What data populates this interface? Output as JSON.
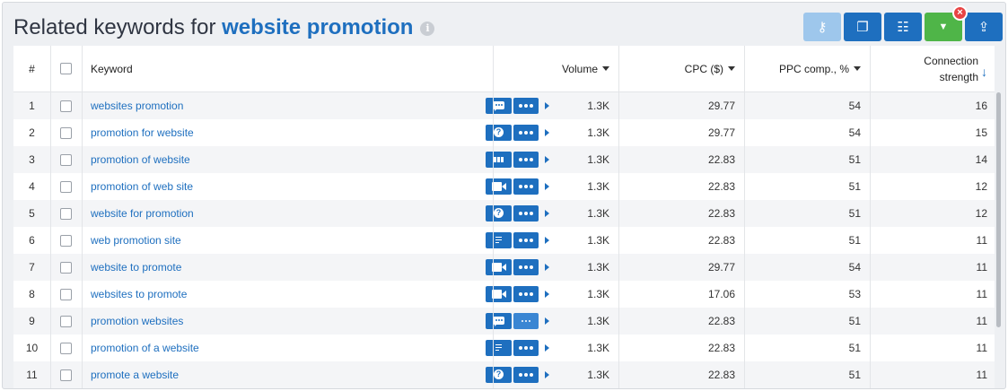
{
  "title": {
    "prefix": "Related keywords for ",
    "keyword": "website promotion",
    "info_icon": "info-icon"
  },
  "toolbar": {
    "buttons": [
      {
        "name": "key-icon",
        "glyph": "⚷"
      },
      {
        "name": "copy-icon",
        "glyph": "❐"
      },
      {
        "name": "columns-icon",
        "glyph": "☷"
      },
      {
        "name": "filter-icon",
        "glyph": "▼"
      },
      {
        "name": "export-icon",
        "glyph": "⇪"
      }
    ],
    "filter_clear_glyph": "×"
  },
  "columns": {
    "num": "#",
    "keyword": "Keyword",
    "volume": "Volume",
    "cpc": "CPC ($)",
    "ppc": "PPC comp., %",
    "connection_line1": "Connection",
    "connection_line2": "strength",
    "connection_sort_glyph": "↓"
  },
  "rows": [
    {
      "num": "1",
      "keyword": "websites promotion",
      "icon": "chat-icon",
      "volume": "1.3K",
      "cpc": "29.77",
      "ppc": "54",
      "connection": "16"
    },
    {
      "num": "2",
      "keyword": "promotion for website",
      "icon": "question-icon",
      "volume": "1.3K",
      "cpc": "29.77",
      "ppc": "54",
      "connection": "15"
    },
    {
      "num": "3",
      "keyword": "promotion of website",
      "icon": "bars-icon",
      "volume": "1.3K",
      "cpc": "22.83",
      "ppc": "51",
      "connection": "14"
    },
    {
      "num": "4",
      "keyword": "promotion of web site",
      "icon": "video-icon",
      "volume": "1.3K",
      "cpc": "22.83",
      "ppc": "51",
      "connection": "12"
    },
    {
      "num": "5",
      "keyword": "website for promotion",
      "icon": "question-icon",
      "volume": "1.3K",
      "cpc": "22.83",
      "ppc": "51",
      "connection": "12"
    },
    {
      "num": "6",
      "keyword": "web promotion site",
      "icon": "text-icon",
      "volume": "1.3K",
      "cpc": "22.83",
      "ppc": "51",
      "connection": "11"
    },
    {
      "num": "7",
      "keyword": "website to promote",
      "icon": "video-icon",
      "volume": "1.3K",
      "cpc": "29.77",
      "ppc": "54",
      "connection": "11"
    },
    {
      "num": "8",
      "keyword": "websites to promote",
      "icon": "video-icon",
      "volume": "1.3K",
      "cpc": "17.06",
      "ppc": "53",
      "connection": "11"
    },
    {
      "num": "9",
      "keyword": "promotion websites",
      "icon": "chat-icon",
      "volume": "1.3K",
      "cpc": "22.83",
      "ppc": "51",
      "connection": "11"
    },
    {
      "num": "10",
      "keyword": "promotion of a website",
      "icon": "text-icon",
      "volume": "1.3K",
      "cpc": "22.83",
      "ppc": "51",
      "connection": "11"
    },
    {
      "num": "11",
      "keyword": "promote a website",
      "icon": "question-icon",
      "volume": "1.3K",
      "cpc": "22.83",
      "ppc": "51",
      "connection": "11"
    }
  ],
  "colors": {
    "accent": "#1e6fbf",
    "accent_light": "#9ec7ec",
    "filter_green": "#4fb548",
    "clear_red": "#e84444"
  }
}
